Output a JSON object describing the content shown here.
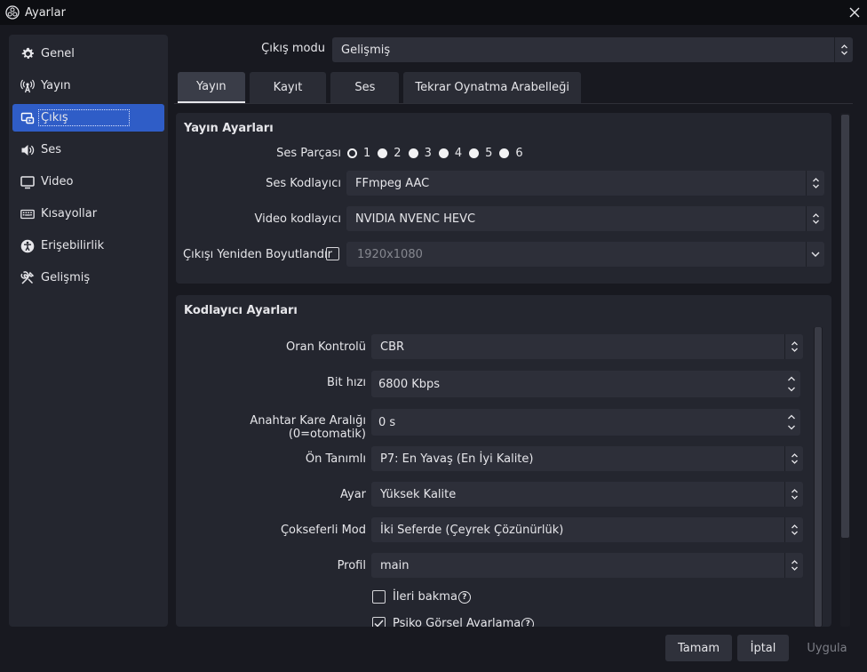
{
  "window": {
    "title": "Ayarlar",
    "close_icon": "close-icon",
    "app_icon": "obs-logo-icon"
  },
  "sidebar": {
    "items": [
      {
        "label": "Genel",
        "icon": "gear-icon"
      },
      {
        "label": "Yayın",
        "icon": "antenna-icon"
      },
      {
        "label": "Çıkış",
        "icon": "output-icon",
        "active": true
      },
      {
        "label": "Ses",
        "icon": "speaker-icon"
      },
      {
        "label": "Video",
        "icon": "monitor-icon"
      },
      {
        "label": "Kısayollar",
        "icon": "keyboard-icon"
      },
      {
        "label": "Erişebilirlik",
        "icon": "accessibility-icon"
      },
      {
        "label": "Gelişmiş",
        "icon": "tools-icon"
      }
    ]
  },
  "output_mode": {
    "label": "Çıkış modu",
    "value": "Gelişmiş"
  },
  "tabs": [
    {
      "label": "Yayın",
      "active": true
    },
    {
      "label": "Kayıt"
    },
    {
      "label": "Ses"
    },
    {
      "label": "Tekrar Oynatma Arabelleği"
    }
  ],
  "stream_settings": {
    "title": "Yayın Ayarları",
    "audio_track": {
      "label": "Ses Parçası",
      "options": [
        "1",
        "2",
        "3",
        "4",
        "5",
        "6"
      ],
      "selected": "1"
    },
    "audio_encoder": {
      "label": "Ses Kodlayıcı",
      "value": "FFmpeg AAC"
    },
    "video_encoder": {
      "label": "Video kodlayıcı",
      "value": "NVIDIA NVENC HEVC"
    },
    "rescale": {
      "label": "Çıkışı Yeniden Boyutlandır",
      "checked": false,
      "value": "1920x1080"
    }
  },
  "encoder_settings": {
    "title": "Kodlayıcı Ayarları",
    "rate_control": {
      "label": "Oran Kontrolü",
      "value": "CBR"
    },
    "bitrate": {
      "label": "Bit hızı",
      "value": "6800 Kbps"
    },
    "keyframe": {
      "label": "Anahtar Kare Aralığı (0=otomatik)",
      "value": "0 s"
    },
    "preset": {
      "label": "Ön Tanımlı",
      "value": "P7: En Yavaş (En İyi Kalite)"
    },
    "tuning": {
      "label": "Ayar",
      "value": "Yüksek Kalite"
    },
    "multipass": {
      "label": "Çokseferli Mod",
      "value": "İki Seferde (Çeyrek Çözünürlük)"
    },
    "profile": {
      "label": "Profil",
      "value": "main"
    },
    "lookahead": {
      "label": "İleri bakma",
      "checked": false,
      "help": "?"
    },
    "psycho_visual": {
      "label": "Psiko Görsel Ayarlama",
      "checked": true,
      "help": "?"
    }
  },
  "buttons": {
    "ok": "Tamam",
    "cancel": "İptal",
    "apply": "Uygula"
  },
  "colors": {
    "accent": "#2f5dc7",
    "background": "#181920",
    "panel": "#24262f",
    "field": "#2d2f39"
  }
}
